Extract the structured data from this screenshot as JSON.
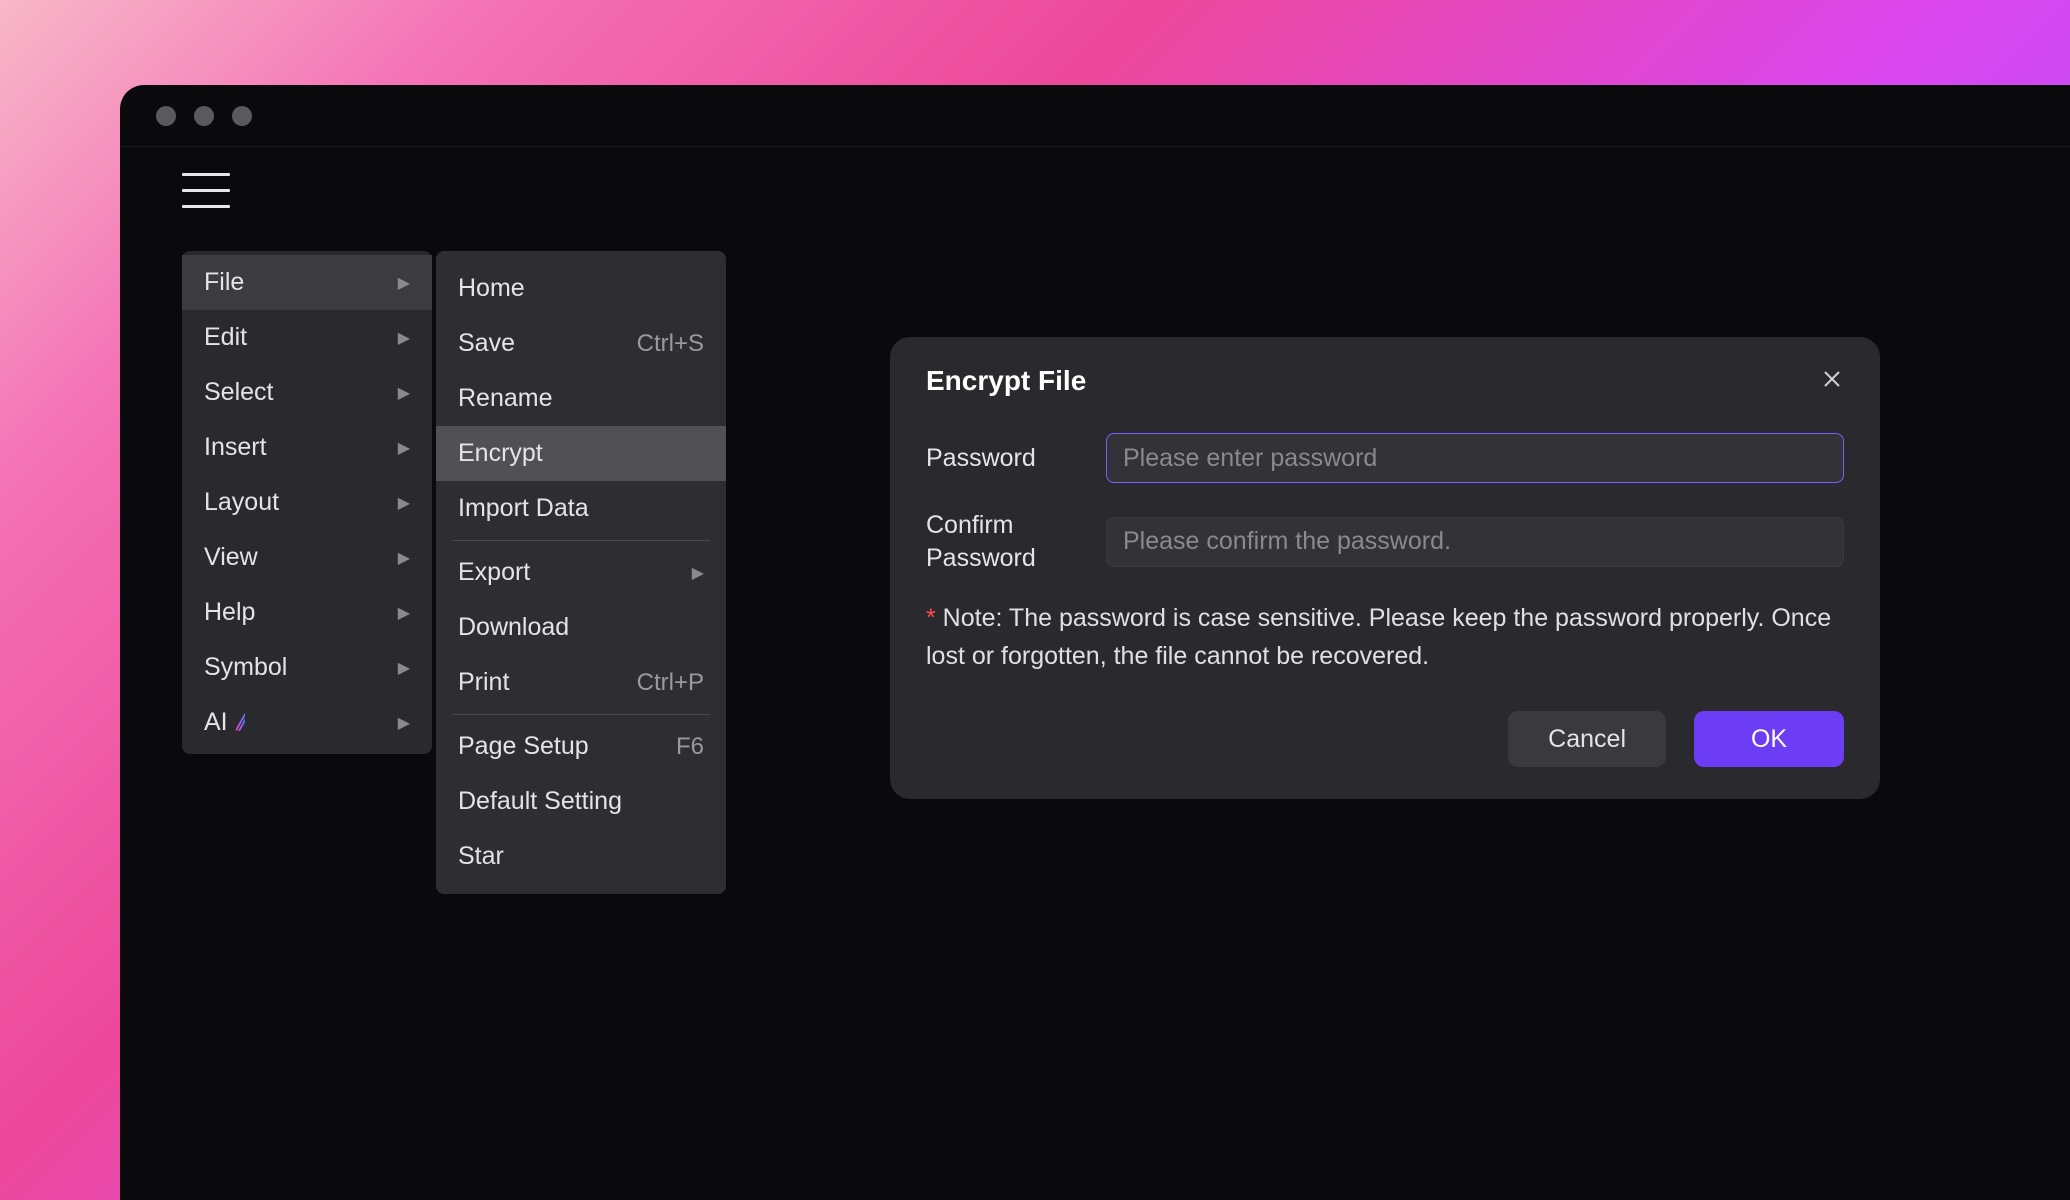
{
  "menu_primary": [
    {
      "label": "File",
      "hasSub": true,
      "active": true
    },
    {
      "label": "Edit",
      "hasSub": true,
      "active": false
    },
    {
      "label": "Select",
      "hasSub": true,
      "active": false
    },
    {
      "label": "Insert",
      "hasSub": true,
      "active": false
    },
    {
      "label": "Layout",
      "hasSub": true,
      "active": false
    },
    {
      "label": "View",
      "hasSub": true,
      "active": false
    },
    {
      "label": "Help",
      "hasSub": true,
      "active": false
    },
    {
      "label": "Symbol",
      "hasSub": true,
      "active": false
    },
    {
      "label": "AI",
      "hasSub": true,
      "active": false,
      "ai": true
    }
  ],
  "menu_secondary_groups": [
    [
      {
        "label": "Home"
      },
      {
        "label": "Save",
        "shortcut": "Ctrl+S"
      },
      {
        "label": "Rename"
      },
      {
        "label": "Encrypt",
        "active": true
      },
      {
        "label": "Import Data"
      }
    ],
    [
      {
        "label": "Export",
        "hasSub": true
      },
      {
        "label": "Download"
      },
      {
        "label": "Print",
        "shortcut": "Ctrl+P"
      }
    ],
    [
      {
        "label": "Page Setup",
        "shortcut": "F6"
      },
      {
        "label": "Default Setting"
      },
      {
        "label": "Star"
      }
    ]
  ],
  "dialog": {
    "title": "Encrypt File",
    "password_label": "Password",
    "password_placeholder": "Please enter password",
    "confirm_label": "Confirm Password",
    "confirm_placeholder": "Please confirm the password.",
    "note_asterisk": "*",
    "note_text": " Note: The password is case sensitive. Please keep the password properly. Once lost or forgotten, the file cannot be recovered.",
    "cancel": "Cancel",
    "ok": "OK"
  }
}
